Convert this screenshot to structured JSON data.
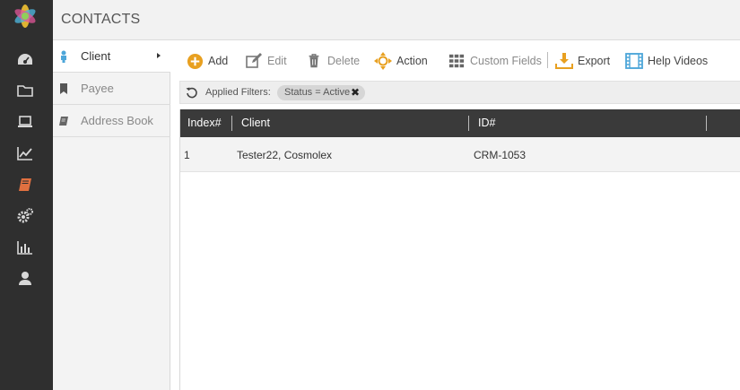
{
  "app": {
    "section_title": "CONTACTS",
    "accent_color": "#e8a020",
    "active_icon_color": "#e07040"
  },
  "rail": {
    "items": [
      {
        "icon": "dashboard-icon"
      },
      {
        "icon": "folder-icon"
      },
      {
        "icon": "laptop-icon"
      },
      {
        "icon": "line-chart-icon"
      },
      {
        "icon": "book-icon",
        "active": true
      },
      {
        "icon": "gears-icon"
      },
      {
        "icon": "bar-chart-icon"
      },
      {
        "icon": "user-icon"
      }
    ]
  },
  "subnav": {
    "items": [
      {
        "label": "Client",
        "icon": "person-icon",
        "active": true
      },
      {
        "label": "Payee",
        "icon": "bookmark-icon"
      },
      {
        "label": "Address Book",
        "icon": "address-book-icon"
      }
    ]
  },
  "toolbar": {
    "add": "Add",
    "edit": "Edit",
    "delete": "Delete",
    "action": "Action",
    "custom_fields": "Custom Fields",
    "export": "Export",
    "help_videos": "Help Videos"
  },
  "filters": {
    "label": "Applied Filters:",
    "chips": [
      {
        "text": "Status = Active"
      }
    ]
  },
  "table": {
    "columns": [
      "Index#",
      "Client",
      "ID#"
    ],
    "rows": [
      {
        "index": "1",
        "client": "Tester22, Cosmolex",
        "id": "CRM-1053"
      }
    ]
  }
}
